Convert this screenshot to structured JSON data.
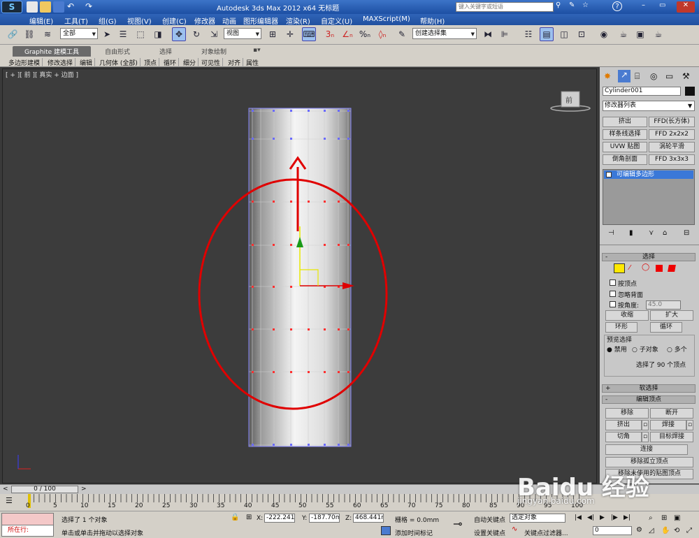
{
  "window": {
    "title": "Autodesk 3ds Max  2012 x64    无标题",
    "search_placeholder": "键入关键字或短语"
  },
  "menu": [
    "编辑(E)",
    "工具(T)",
    "组(G)",
    "视图(V)",
    "创建(C)",
    "修改器",
    "动画",
    "图形编辑器",
    "渲染(R)",
    "自定义(U)",
    "MAXScript(M)",
    "帮助(H)"
  ],
  "toolbar": {
    "selection_filter": "全部",
    "ref_coord": "视图",
    "named_selection": "创建选择集"
  },
  "ribbon": {
    "tabs": [
      "Graphite 建模工具",
      "自由形式",
      "选择",
      "对象绘制"
    ],
    "subtabs": [
      "多边形建模",
      "修改选择",
      "编辑",
      "几何体 (全部)",
      "顶点",
      "循环",
      "细分",
      "可见性",
      "对齐",
      "属性"
    ]
  },
  "viewport": {
    "label": "[ + ][ 前 ][ 真实 + 边面 ]",
    "viewcube": "前"
  },
  "panel": {
    "object_name": "Cylinder001",
    "modifier_list": "修改器列表",
    "mod_buttons": [
      "挤出",
      "FFD(长方体)",
      "样条线选择",
      "FFD 2x2x2",
      "UVW 贴图",
      "涡轮平滑",
      "倒角剖面",
      "FFD 3x3x3"
    ],
    "stack_item": "可编辑多边形",
    "selection": {
      "rollout": "选择",
      "by_vertex": "按顶点",
      "ignore_backfacing": "忽略背面",
      "by_angle": "按角度:",
      "angle_value": "45.0",
      "shrink": "收缩",
      "grow": "扩大",
      "ring": "环形",
      "loop": "循环",
      "preview": "预览选择",
      "disable": "禁用",
      "subobject": "子对象",
      "multi": "多个",
      "status": "选择了 90 个顶点"
    },
    "soft_selection": "软选择",
    "edit_vertices": {
      "rollout": "编辑顶点",
      "remove": "移除",
      "break": "断开",
      "extrude": "挤出",
      "weld": "焊接",
      "chamfer": "切角",
      "target_weld": "目标焊接",
      "connect": "连接",
      "remove_isolated": "移除孤立顶点",
      "remove_unused": "移除未使用的贴图顶点"
    }
  },
  "timeline": {
    "frame": "0 / 100",
    "ticks": [
      "0",
      "5",
      "10",
      "15",
      "20",
      "25",
      "30",
      "35",
      "40",
      "45",
      "50",
      "55",
      "60",
      "65",
      "70",
      "75",
      "80",
      "85",
      "90",
      "95",
      "100"
    ]
  },
  "status": {
    "running": "所在行:",
    "selected": "选择了 1 个对象",
    "prompt": "单击或单击并拖动以选择对象",
    "x_label": "X:",
    "x": "-222.241m",
    "y_label": "Y:",
    "y": "-187.70m",
    "z_label": "Z:",
    "z": "468.441m",
    "grid": "栅格 = 0.0mm",
    "add_time_tag": "添加时间标记",
    "auto_key": "自动关键点",
    "selected_obj": "选定对象",
    "set_key": "设置关键点",
    "key_filters": "关键点过滤器...",
    "frame_field": "0"
  },
  "watermark": "Baidu 经验",
  "watermark_url": "jingyan.baidu.com",
  "colors": {
    "title_bar": "#2a5fb5",
    "annotation": "#e00000",
    "stack_selected": "#3a78d8"
  }
}
